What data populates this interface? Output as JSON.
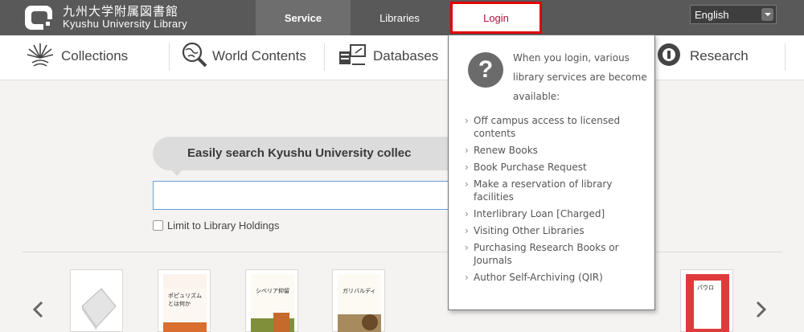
{
  "header": {
    "logo_ja": "九州大学附属図書館",
    "logo_en": "Kyushu University Library",
    "nav": [
      {
        "label": "Service"
      },
      {
        "label": "Libraries"
      },
      {
        "label": "Login"
      }
    ],
    "language": "English"
  },
  "menu": [
    {
      "label": "Collections",
      "icon": "collections-icon"
    },
    {
      "label": "World Contents",
      "icon": "world-contents-icon"
    },
    {
      "label": "Databases",
      "icon": "databases-icon"
    },
    {
      "label": "Research",
      "icon": "research-icon"
    }
  ],
  "search": {
    "prompt": "Easily search Kyushu University collec",
    "input_value": "",
    "limit_label": "Limit to Library Holdings",
    "limit_checked": false
  },
  "login_dropdown": {
    "intro": "When you login, various library services are become available:",
    "items": [
      "Off campus access to licensed contents",
      "Renew Books",
      "Book Purchase Request",
      "Make a reservation of library facilities",
      "Interlibrary Loan [Charged]",
      "Visiting Other Libraries",
      "Purchasing Research Books or Journals",
      "Author Self-Archiving (QIR)"
    ]
  },
  "books": {
    "titles": [
      "ポピュリズムとは何か",
      "シベリア抑留",
      "ガリバルディ",
      "パウロ"
    ]
  },
  "colors": {
    "topbar": "#595959",
    "active_tab": "#6e6e6e",
    "login_highlight": "#e00000",
    "login_text": "#b0103a"
  }
}
